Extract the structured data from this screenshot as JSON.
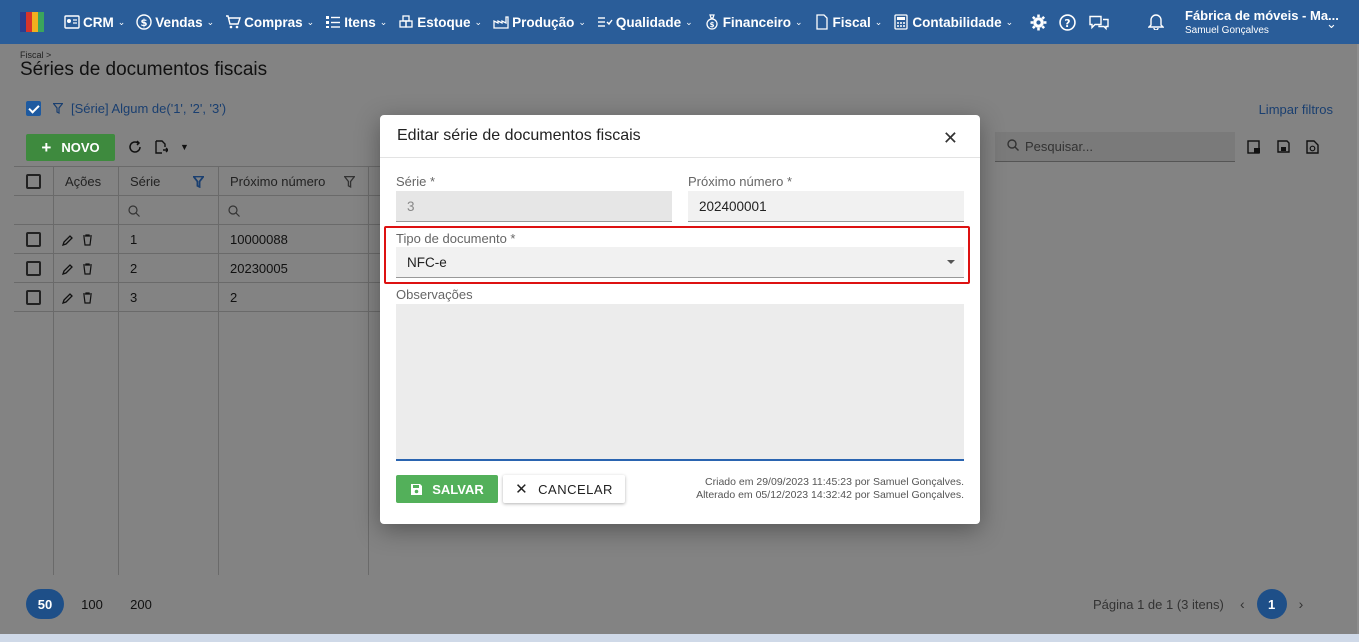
{
  "nav": {
    "items": [
      {
        "label": "CRM",
        "icon": "contact-card-icon"
      },
      {
        "label": "Vendas",
        "icon": "dollar-circle-icon"
      },
      {
        "label": "Compras",
        "icon": "cart-icon"
      },
      {
        "label": "Itens",
        "icon": "list-icon"
      },
      {
        "label": "Estoque",
        "icon": "boxes-icon"
      },
      {
        "label": "Produção",
        "icon": "factory-icon"
      },
      {
        "label": "Qualidade",
        "icon": "checklist-icon"
      },
      {
        "label": "Financeiro",
        "icon": "money-bag-icon"
      },
      {
        "label": "Fiscal",
        "icon": "document-icon"
      },
      {
        "label": "Contabilidade",
        "icon": "calculator-icon"
      }
    ]
  },
  "company": {
    "name": "Fábrica de móveis - Ma...",
    "user": "Samuel Gonçalves"
  },
  "page": {
    "breadcrumb": "Fiscal >",
    "title": "Séries de documentos fiscais",
    "filter_text": "[Série] Algum de('1', '2', '3')",
    "clear_filters": "Limpar filtros",
    "new_button": "NOVO",
    "search_placeholder": "Pesquisar..."
  },
  "grid": {
    "columns": [
      "Ações",
      "Série",
      "Próximo número"
    ],
    "rows": [
      {
        "serie": "1",
        "proximo": "10000088"
      },
      {
        "serie": "2",
        "proximo": "20230005"
      },
      {
        "serie": "3",
        "proximo": "2"
      }
    ]
  },
  "pagination": {
    "sizes": [
      "50",
      "100",
      "200"
    ],
    "info": "Página 1 de 1 (3 itens)",
    "current": "1"
  },
  "modal": {
    "title": "Editar série de documentos fiscais",
    "serie_label": "Série *",
    "serie_value": "3",
    "proximo_label": "Próximo número *",
    "proximo_value": "202400001",
    "tipo_label": "Tipo de documento *",
    "tipo_value": "NFC-e",
    "obs_label": "Observações",
    "save": "SALVAR",
    "cancel": "CANCELAR",
    "created": "Criado em 29/09/2023 11:45:23 por Samuel Gonçalves.",
    "updated": "Alterado em 05/12/2023 14:32:42 por Samuel Gonçalves."
  },
  "colors": {
    "topbar": "#2a5d99",
    "primary": "#1e4f88",
    "success": "#53b05a",
    "highlight": "#d11111"
  }
}
